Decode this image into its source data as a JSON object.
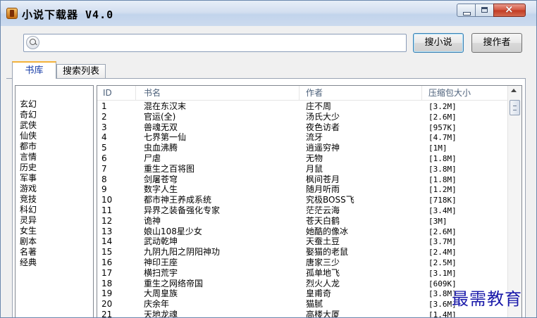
{
  "window": {
    "title": "小说下载器 V4.0",
    "controls": {
      "minimize": "minimize",
      "maximize": "maximize",
      "close": "×"
    }
  },
  "search": {
    "placeholder": "",
    "value": ""
  },
  "buttons": {
    "search_novel": "搜小说",
    "search_author": "搜作者"
  },
  "tabs": [
    {
      "label": "书库",
      "active": true
    },
    {
      "label": "搜索列表",
      "active": false
    }
  ],
  "categories": [
    "玄幻",
    "奇幻",
    "武侠",
    "仙侠",
    "都市",
    "言情",
    "历史",
    "军事",
    "游戏",
    "竞技",
    "科幻",
    "灵异",
    "女生",
    "剧本",
    "名著",
    "经典"
  ],
  "table": {
    "columns": [
      "ID",
      "书名",
      "作者",
      "压缩包大小"
    ],
    "rows": [
      [
        "1",
        "混在东汉末",
        "庄不周",
        "[3.2M]"
      ],
      [
        "2",
        "官运(全)",
        "汤氏大少",
        "[2.6M]"
      ],
      [
        "3",
        "兽魂无双",
        "夜色访者",
        "[957K]"
      ],
      [
        "4",
        "七界第一仙",
        "流牙",
        "[4.7M]"
      ],
      [
        "5",
        "虫血沸腾",
        "逍遥穷神",
        "[1M]"
      ],
      [
        "6",
        "尸虐",
        "无物",
        "[1.8M]"
      ],
      [
        "7",
        "重生之百将图",
        "月鼠",
        "[3.8M]"
      ],
      [
        "8",
        "剑屠苍穹",
        "枫间苍月",
        "[1.8M]"
      ],
      [
        "9",
        "数字人生",
        "随月听雨",
        "[1.2M]"
      ],
      [
        "10",
        "都市神王养成系统",
        "究极BOSS飞",
        "[718K]"
      ],
      [
        "11",
        "异界之装备强化专家",
        "茫茫云海",
        "[3.4M]"
      ],
      [
        "12",
        "诡神",
        "苍天白鹤",
        "[3M]"
      ],
      [
        "13",
        "娘山108星少女",
        "她酷的像冰",
        "[2.6M]"
      ],
      [
        "14",
        "武动乾坤",
        "天蚕土豆",
        "[3.7M]"
      ],
      [
        "15",
        "九阴九阳之阴阳神功",
        "娶猫的老鼠",
        "[2.4M]"
      ],
      [
        "16",
        "神印王座",
        "唐家三少",
        "[2.5M]"
      ],
      [
        "17",
        "横扫荒宇",
        "孤单地飞",
        "[3.1M]"
      ],
      [
        "18",
        "重生之网络帝国",
        "烈火人龙",
        "[609K]"
      ],
      [
        "19",
        "大周皇族",
        "皇甫奇",
        "[3.8M]"
      ],
      [
        "20",
        "庆余年",
        "猫腻",
        "[3.6M]"
      ],
      [
        "21",
        "天地龙魂",
        "高楼大厦",
        "[1.4M]"
      ]
    ]
  },
  "watermark": "最需教育"
}
